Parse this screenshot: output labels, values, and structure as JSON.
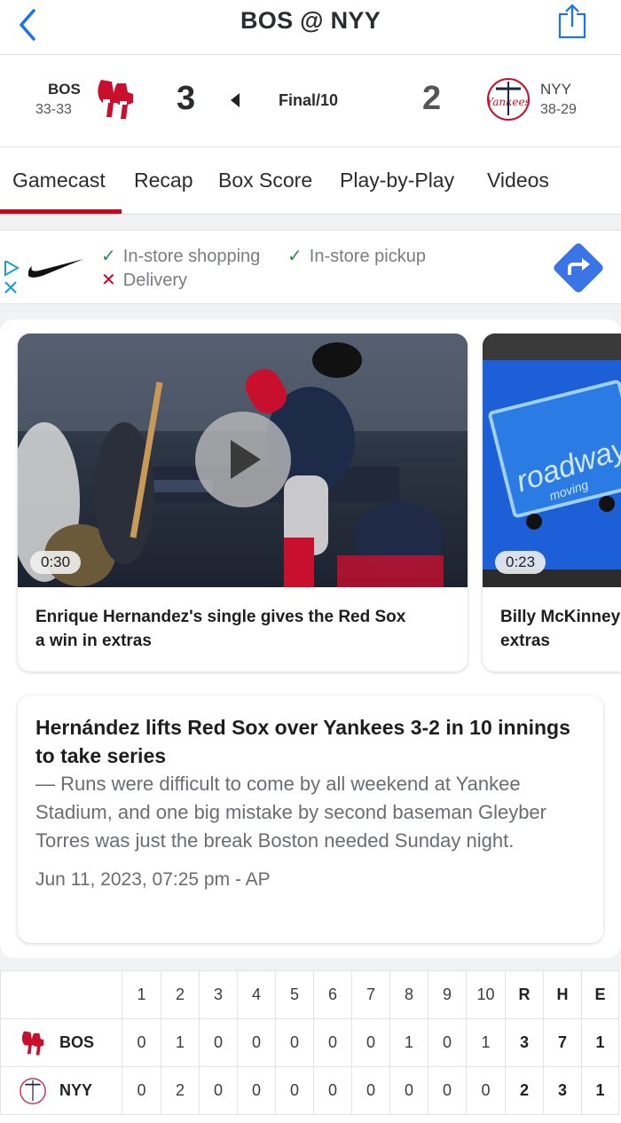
{
  "header": {
    "title": "BOS @ NYY"
  },
  "scoreboard": {
    "away": {
      "abbr": "BOS",
      "record": "33-33",
      "score": "3"
    },
    "home": {
      "abbr": "NYY",
      "record": "38-29",
      "score": "2"
    },
    "status": "Final/10"
  },
  "tabs": [
    "Gamecast",
    "Recap",
    "Box Score",
    "Play-by-Play",
    "Videos"
  ],
  "ad": {
    "features": [
      {
        "mark": "✓",
        "label": "In-store shopping"
      },
      {
        "mark": "✓",
        "label": "In-store pickup"
      },
      {
        "mark": "✕",
        "label": "Delivery"
      }
    ]
  },
  "videos": [
    {
      "duration": "0:30",
      "title_line1": "Enrique Hernandez's single gives the Red Sox",
      "title_line2": "a win in extras"
    },
    {
      "duration": "0:23",
      "title_line1": "Billy McKinney",
      "title_line2": "extras"
    }
  ],
  "story": {
    "headline": "Hernández lifts Red Sox over Yankees 3-2 in 10 innings to take series",
    "summary": "— Runs were difficult to come by all weekend at Yankee Stadium, and one big mistake by second baseman Gleyber Torres was just the break Boston needed Sunday night.",
    "meta": "Jun 11, 2023, 07:25 pm - AP"
  },
  "linescore": {
    "columns": [
      "1",
      "2",
      "3",
      "4",
      "5",
      "6",
      "7",
      "8",
      "9",
      "10",
      "R",
      "H",
      "E"
    ],
    "rows": [
      {
        "team": "BOS",
        "values": [
          "0",
          "1",
          "0",
          "0",
          "0",
          "0",
          "0",
          "1",
          "0",
          "1",
          "3",
          "7",
          "1"
        ]
      },
      {
        "team": "NYY",
        "values": [
          "0",
          "2",
          "0",
          "0",
          "0",
          "0",
          "0",
          "0",
          "0",
          "0",
          "2",
          "3",
          "1"
        ]
      }
    ]
  }
}
